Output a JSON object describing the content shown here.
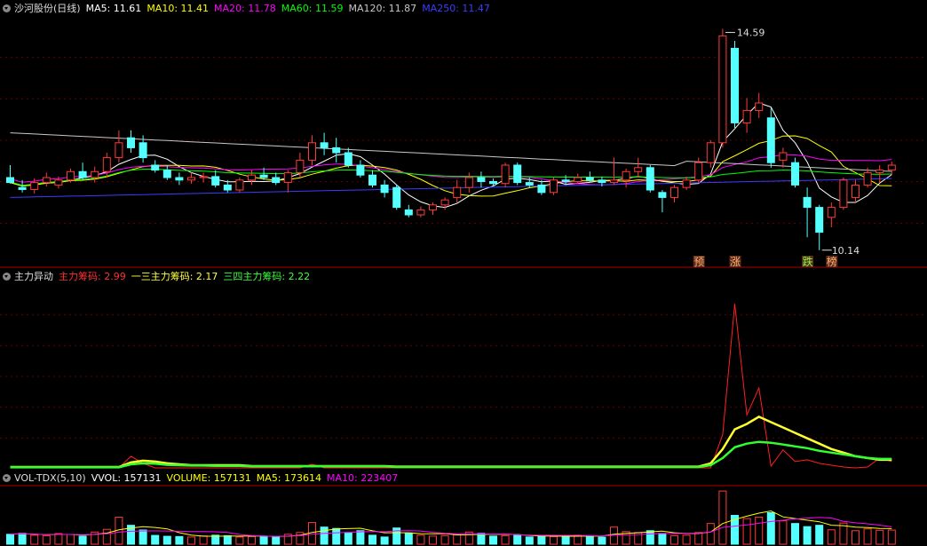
{
  "panel1": {
    "title": "沙河股份(日线)",
    "ma_items": [
      {
        "label": "MA5: 11.61",
        "color": "#ffffff"
      },
      {
        "label": "MA10: 11.41",
        "color": "#ffff00"
      },
      {
        "label": "MA20: 11.78",
        "color": "#ff00ff"
      },
      {
        "label": "MA60: 11.59",
        "color": "#00ff00"
      },
      {
        "label": "MA120: 11.87",
        "color": "#c8c8c8"
      },
      {
        "label": "MA250: 11.47",
        "color": "#3c3cff"
      }
    ],
    "high_label": "14.59",
    "low_label": "10.14",
    "tags": [
      {
        "text": "预"
      },
      {
        "text": "涨"
      },
      {
        "text": "跌"
      },
      {
        "text": "榜"
      }
    ]
  },
  "panel2": {
    "title": "主力异动",
    "items": [
      {
        "label": "主力筹码: 2.99",
        "color": "#ff3030"
      },
      {
        "label": "一三主力筹码: 2.17",
        "color": "#ffff40"
      },
      {
        "label": "三四主力筹码: 2.22",
        "color": "#40ff40"
      }
    ]
  },
  "panel3": {
    "title": "VOL-TDX(5,10)",
    "items": [
      {
        "label": "VVOL: 157131",
        "color": "#ffffff"
      },
      {
        "label": "VOLUME: 157131",
        "color": "#ffff00"
      },
      {
        "label": "MA5: 173614",
        "color": "#ffff00"
      },
      {
        "label": "MA10: 223407",
        "color": "#ff00ff"
      }
    ]
  },
  "colors": {
    "up": "#ff3a3a",
    "down": "#54ffff",
    "separator": "#b00000",
    "grid": "#600000"
  },
  "chart_data": {
    "type": "candlestick",
    "price_range": [
      10.14,
      14.59
    ],
    "candles": [
      [
        11.6,
        11.85,
        11.48,
        11.5
      ],
      [
        11.4,
        11.55,
        11.3,
        11.36
      ],
      [
        11.36,
        11.58,
        11.28,
        11.5
      ],
      [
        11.5,
        11.7,
        11.42,
        11.6
      ],
      [
        11.45,
        11.62,
        11.38,
        11.55
      ],
      [
        11.55,
        11.78,
        11.5,
        11.72
      ],
      [
        11.72,
        11.9,
        11.55,
        11.6
      ],
      [
        11.6,
        11.82,
        11.5,
        11.72
      ],
      [
        11.72,
        12.1,
        11.6,
        12.0
      ],
      [
        12.0,
        12.55,
        11.9,
        12.3
      ],
      [
        12.4,
        12.55,
        12.1,
        12.2
      ],
      [
        12.3,
        12.45,
        11.9,
        12.0
      ],
      [
        11.85,
        11.95,
        11.7,
        11.75
      ],
      [
        11.75,
        11.85,
        11.55,
        11.6
      ],
      [
        11.6,
        11.7,
        11.45,
        11.55
      ],
      [
        11.55,
        11.7,
        11.48,
        11.6
      ],
      [
        11.6,
        11.7,
        11.5,
        11.62
      ],
      [
        11.62,
        11.75,
        11.4,
        11.45
      ],
      [
        11.45,
        11.55,
        11.3,
        11.35
      ],
      [
        11.35,
        11.6,
        11.3,
        11.55
      ],
      [
        11.55,
        11.75,
        11.45,
        11.65
      ],
      [
        11.65,
        11.8,
        11.55,
        11.6
      ],
      [
        11.6,
        11.7,
        11.45,
        11.5
      ],
      [
        11.5,
        11.75,
        11.3,
        11.7
      ],
      [
        11.7,
        12.1,
        11.6,
        11.95
      ],
      [
        11.95,
        12.45,
        11.85,
        12.3
      ],
      [
        12.3,
        12.5,
        12.05,
        12.2
      ],
      [
        12.2,
        12.4,
        11.9,
        12.1
      ],
      [
        12.1,
        12.2,
        11.8,
        11.85
      ],
      [
        11.85,
        11.95,
        11.6,
        11.65
      ],
      [
        11.65,
        11.75,
        11.4,
        11.45
      ],
      [
        11.45,
        11.55,
        11.2,
        11.3
      ],
      [
        11.4,
        11.45,
        10.95,
        11.0
      ],
      [
        10.95,
        11.05,
        10.8,
        10.85
      ],
      [
        10.85,
        11.02,
        10.8,
        10.95
      ],
      [
        10.95,
        11.1,
        10.85,
        11.05
      ],
      [
        11.05,
        11.2,
        10.95,
        11.15
      ],
      [
        11.2,
        11.55,
        11.1,
        11.4
      ],
      [
        11.4,
        11.7,
        11.3,
        11.6
      ],
      [
        11.6,
        11.72,
        11.4,
        11.52
      ],
      [
        11.52,
        11.58,
        11.42,
        11.48
      ],
      [
        11.48,
        11.9,
        11.4,
        11.85
      ],
      [
        11.85,
        11.9,
        11.45,
        11.5
      ],
      [
        11.5,
        11.6,
        11.4,
        11.45
      ],
      [
        11.45,
        11.55,
        11.25,
        11.3
      ],
      [
        11.3,
        11.6,
        11.25,
        11.55
      ],
      [
        11.55,
        11.65,
        11.45,
        11.52
      ],
      [
        11.52,
        11.68,
        11.48,
        11.6
      ],
      [
        11.6,
        11.72,
        11.5,
        11.55
      ],
      [
        11.55,
        11.62,
        11.42,
        11.5
      ],
      [
        11.5,
        12.0,
        11.45,
        11.55
      ],
      [
        11.55,
        11.78,
        11.4,
        11.72
      ],
      [
        11.72,
        12.0,
        11.6,
        11.8
      ],
      [
        11.8,
        11.85,
        11.3,
        11.35
      ],
      [
        11.3,
        11.35,
        10.9,
        11.2
      ],
      [
        11.2,
        11.45,
        11.1,
        11.4
      ],
      [
        11.4,
        11.62,
        11.35,
        11.55
      ],
      [
        11.55,
        12.0,
        11.5,
        11.9
      ],
      [
        11.9,
        12.35,
        11.8,
        12.3
      ],
      [
        12.3,
        14.59,
        12.2,
        14.45
      ],
      [
        14.2,
        14.35,
        12.6,
        12.7
      ],
      [
        12.7,
        13.2,
        12.5,
        12.95
      ],
      [
        12.95,
        13.3,
        12.8,
        13.1
      ],
      [
        12.8,
        13.0,
        11.8,
        11.9
      ],
      [
        11.95,
        12.2,
        11.8,
        12.1
      ],
      [
        11.9,
        12.0,
        11.4,
        11.45
      ],
      [
        11.2,
        11.4,
        10.4,
        11.0
      ],
      [
        11.0,
        11.05,
        10.14,
        10.5
      ],
      [
        10.8,
        11.1,
        10.6,
        11.0
      ],
      [
        11.0,
        11.6,
        10.95,
        11.55
      ],
      [
        11.2,
        11.55,
        11.1,
        11.45
      ],
      [
        11.45,
        11.8,
        11.4,
        11.7
      ],
      [
        11.7,
        11.85,
        11.5,
        11.75
      ],
      [
        11.75,
        11.92,
        11.65,
        11.85
      ]
    ],
    "volume_range": [
      0,
      640000
    ],
    "volumes": [
      110000,
      120000,
      100000,
      95000,
      118000,
      108000,
      90000,
      135000,
      165000,
      300000,
      210000,
      158000,
      98000,
      88000,
      85000,
      80000,
      92000,
      100000,
      95000,
      80000,
      85000,
      90000,
      80000,
      110000,
      130000,
      240000,
      190000,
      175000,
      130000,
      150000,
      100000,
      80000,
      180000,
      125000,
      100000,
      90000,
      95000,
      105000,
      135000,
      120000,
      90000,
      95000,
      100000,
      80000,
      88000,
      85000,
      90000,
      100000,
      95000,
      78000,
      190000,
      140000,
      130000,
      150000,
      120000,
      95000,
      100000,
      130000,
      230000,
      590000,
      320000,
      285000,
      300000,
      350000,
      260000,
      230000,
      195000,
      210000,
      160000,
      235000,
      150000,
      170000,
      155000,
      157131
    ],
    "indicator_series": [
      {
        "name": "主力筹码",
        "values": [
          0.05,
          0.05,
          0.05,
          0.05,
          0.05,
          0.05,
          0.05,
          0.05,
          0.05,
          0.05,
          0.7,
          0.3,
          0.05,
          0.05,
          0.05,
          0.05,
          0.05,
          0.05,
          0.05,
          0.05,
          0.05,
          0.05,
          0.05,
          0.05,
          0.05,
          0.25,
          0.05,
          0.05,
          0.05,
          0.05,
          0.05,
          0.05,
          0.05,
          0.05,
          0.05,
          0.05,
          0.05,
          0.05,
          0.05,
          0.05,
          0.05,
          0.05,
          0.05,
          0.05,
          0.05,
          0.05,
          0.05,
          0.05,
          0.05,
          0.05,
          0.05,
          0.05,
          0.05,
          0.05,
          0.05,
          0.05,
          0.05,
          0.05,
          0.05,
          1.9,
          9.2,
          3.0,
          4.5,
          0.15,
          1.05,
          0.4,
          0.5,
          0.3,
          0.2,
          0.1,
          0.05,
          0.1,
          0.6,
          0.4
        ]
      },
      {
        "name": "一三主力筹码",
        "values": [
          0.1,
          0.1,
          0.1,
          0.1,
          0.1,
          0.1,
          0.1,
          0.1,
          0.1,
          0.1,
          0.35,
          0.45,
          0.4,
          0.3,
          0.25,
          0.2,
          0.2,
          0.2,
          0.2,
          0.2,
          0.15,
          0.15,
          0.15,
          0.15,
          0.15,
          0.15,
          0.15,
          0.15,
          0.15,
          0.15,
          0.15,
          0.15,
          0.12,
          0.12,
          0.12,
          0.12,
          0.12,
          0.12,
          0.12,
          0.12,
          0.12,
          0.12,
          0.12,
          0.12,
          0.12,
          0.12,
          0.12,
          0.12,
          0.12,
          0.12,
          0.12,
          0.12,
          0.12,
          0.12,
          0.12,
          0.12,
          0.12,
          0.12,
          0.3,
          1.1,
          2.2,
          2.5,
          2.9,
          2.6,
          2.3,
          2.0,
          1.7,
          1.4,
          1.1,
          0.9,
          0.7,
          0.6,
          0.5,
          0.5
        ]
      },
      {
        "name": "三四主力筹码",
        "values": [
          0.08,
          0.08,
          0.08,
          0.08,
          0.08,
          0.08,
          0.08,
          0.08,
          0.08,
          0.08,
          0.25,
          0.3,
          0.28,
          0.22,
          0.2,
          0.18,
          0.18,
          0.16,
          0.16,
          0.16,
          0.14,
          0.14,
          0.14,
          0.14,
          0.14,
          0.14,
          0.14,
          0.14,
          0.14,
          0.14,
          0.14,
          0.14,
          0.1,
          0.1,
          0.1,
          0.1,
          0.1,
          0.1,
          0.1,
          0.1,
          0.1,
          0.1,
          0.1,
          0.1,
          0.1,
          0.1,
          0.1,
          0.1,
          0.1,
          0.1,
          0.1,
          0.1,
          0.1,
          0.1,
          0.1,
          0.1,
          0.1,
          0.1,
          0.2,
          0.6,
          1.2,
          1.4,
          1.5,
          1.45,
          1.35,
          1.25,
          1.15,
          1.0,
          0.9,
          0.8,
          0.7,
          0.6,
          0.55,
          0.55
        ]
      }
    ],
    "indicator_range": [
      0,
      10
    ]
  }
}
